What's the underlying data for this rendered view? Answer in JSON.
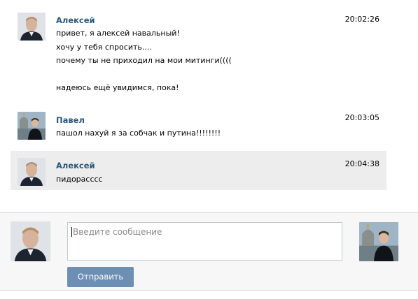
{
  "messages": [
    {
      "author": "Алексей",
      "time": "20:02:26",
      "lines": [
        "привет, я алексей навальный!",
        "хочу у тебя спросить....",
        "почему ты не приходил на мои митинги((((",
        "",
        "надеюсь ещё увидимся, пока!"
      ]
    },
    {
      "author": "Павел",
      "time": "20:03:05",
      "lines": [
        "пашол нахуй я за собчак и путина!!!!!!!!"
      ]
    },
    {
      "author": "Алексей",
      "time": "20:04:38",
      "lines": [
        "пидорасссс"
      ]
    }
  ],
  "compose": {
    "placeholder": "Введите сообщение",
    "send_label": "Отправить"
  },
  "colors": {
    "author_link": "#2b587a",
    "highlight_bg": "#ededed",
    "send_button": "#6d8fb3"
  }
}
